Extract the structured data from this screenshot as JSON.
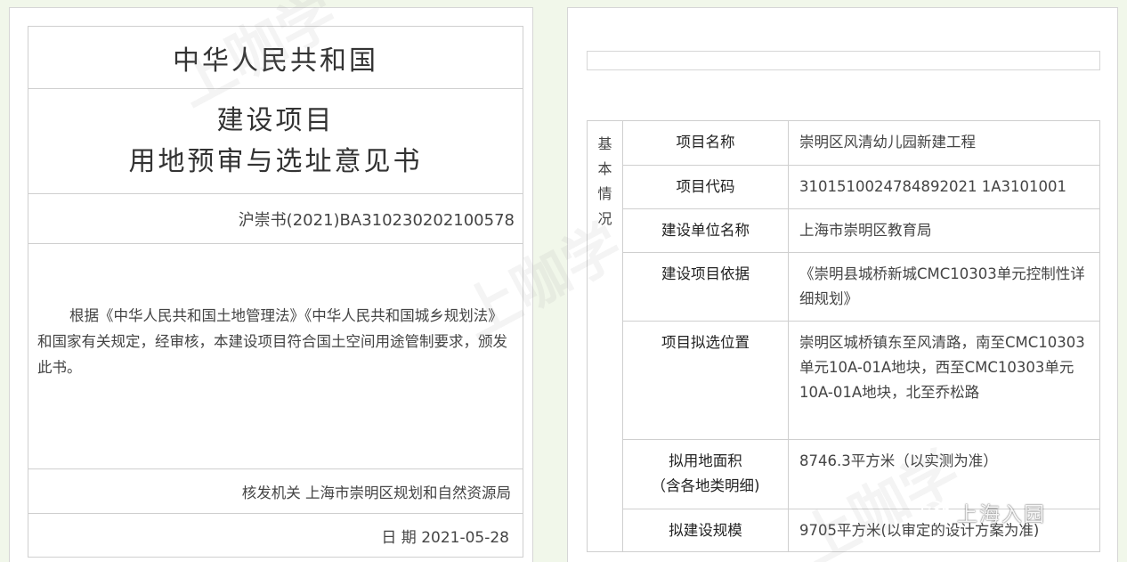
{
  "left_page": {
    "country": "中华人民共和国",
    "title_line1": "建设项目",
    "title_line2": "用地预审与选址意见书",
    "doc_code": "沪崇书(2021)BA310230202100578",
    "body_text": "根据《中华人民共和国土地管理法》《中华人民共和国城乡规划法》和国家有关规定，经审核，本建设项目符合国土空间用途管制要求，颁发此书。",
    "issuer": "核发机关 上海市崇明区规划和自然资源局",
    "date": "日 期 2021-05-28"
  },
  "right_page": {
    "side_header": [
      "基",
      "本",
      "情",
      "况"
    ],
    "rows": [
      {
        "label": "项目名称",
        "value": "崇明区风清幼儿园新建工程"
      },
      {
        "label": "项目代码",
        "value": "3101510024784892021 1A3101001"
      },
      {
        "label": "建设单位名称",
        "value": "上海市崇明区教育局"
      },
      {
        "label": "建设项目依据",
        "value": "《崇明县城桥新城CMC10303单元控制性详细规划》"
      },
      {
        "label": "项目拟选位置",
        "value": "崇明区城桥镇东至风清路，南至CMC10303单元10A-01A地块，西至CMC10303单元10A-01A地块，北至乔松路"
      },
      {
        "label": "拟用地面积\n（含各地类明细)",
        "value": "8746.3平方米（以实测为准）"
      },
      {
        "label": "拟建设规模",
        "value": "9705平方米(以审定的设计方案为准)"
      }
    ]
  },
  "watermarks": {
    "brand": "上咖学",
    "wechat_account": "上海入园"
  }
}
